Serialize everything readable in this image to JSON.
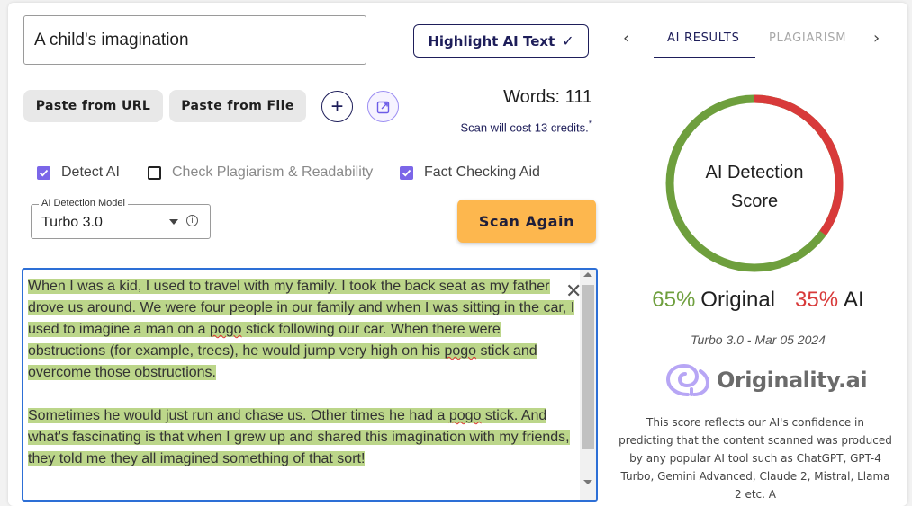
{
  "editor": {
    "title_value": "A child's imagination",
    "highlight_label": "Highlight AI Text",
    "paste_url_label": "Paste from URL",
    "paste_file_label": "Paste from File",
    "plus_icon": "plus-icon",
    "export_icon": "export-icon",
    "words_text": "Words: 111",
    "credits_text": "Scan will cost 13 credits.",
    "credits_asterisk": "*",
    "options": {
      "detect_ai": {
        "label": "Detect AI",
        "checked": true
      },
      "plagiarism": {
        "label": "Check Plagiarism & Readability",
        "checked": false
      },
      "fact_check": {
        "label": "Fact Checking Aid",
        "checked": true
      }
    },
    "model_legend": "AI Detection Model",
    "model_value": "Turbo 3.0",
    "scan_label": "Scan Again",
    "text": {
      "p1_a": "When I was a kid, I used to travel with my family. I took the back seat as my father drove us around. We were four people in our family and when I was sitting in the car, I used to imagine a man on a ",
      "p1_pogo1": "pogo",
      "p1_b": " stick following our car. When there were obstructions (for example, trees), he would jump very high on his ",
      "p1_pogo2": "pogo",
      "p1_c": " stick and overcome those obstructions.",
      "p2_a": "Sometimes he would just run and chase us. Other times he had a ",
      "p2_pogo": "pogo",
      "p2_b": " stick. And what's fascinating is that when I grew up and shared this imagination with my friends, they told me they all imagined something of that sort!"
    },
    "highlight_color": "#bcd68a"
  },
  "results": {
    "tab_ai": "AI RESULTS",
    "tab_plagiarism": "PLAGIARISM",
    "prev_label": "‹",
    "next_label": "›",
    "donut_label_line1": "AI Detection",
    "donut_label_line2": "Score",
    "original_pct": 65,
    "ai_pct": 35,
    "original_pct_text": "65%",
    "original_word": "Original",
    "ai_pct_text": "35%",
    "ai_word": "AI",
    "original_color": "#6e9f3d",
    "ai_color": "#d83a3a",
    "model_date": "Turbo 3.0 - Mar 05 2024",
    "logo_text": "Originality.ai",
    "description": "This score reflects our AI's confidence in predicting that the content scanned was produced by any popular AI tool such as ChatGPT, GPT-4 Turbo, Gemini Advanced, Claude 2, Mistral, Llama 2 etc. A"
  }
}
